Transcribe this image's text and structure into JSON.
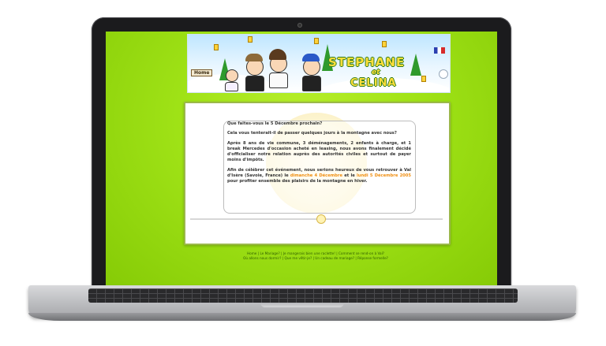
{
  "banner": {
    "title_line1": "STEPHANE",
    "title_et": "et",
    "title_line2": "CELINA",
    "home_sign": "Home"
  },
  "content": {
    "q1": "Que faites-vous le 5 Décembre prochain?",
    "q2": "Cela vous tenterait-il de passer quelques jours à la montagne avec nous?",
    "p1": "Après 8 ans de vie commune, 3 déménagements, 2 enfants à charge, et 1 break Mercedes d'occasion acheté en leasing, nous avons finalement décidé d'officialiser notre relation auprès des autorités civiles et surtout de payer moins d'impôts.",
    "p2_start": "Afin de célébrer cet événement, nous serions heureux de vous retrouver à Val d'Isère (Savoie, France) le ",
    "p2_date1": "dimanche 4 Décembre",
    "p2_mid": " et le ",
    "p2_date2": "lundi 5 Décembre 2005",
    "p2_end": " pour profiter ensemble des plaisirs de la montagne en hiver."
  },
  "footer": {
    "line1": [
      "Home",
      "Le Mariage?",
      "Je mangerais bien une raclette!",
      "Comment se rend-on à Val?"
    ],
    "line2": [
      "Où allons nous dormir?",
      "Que me vêtir-je?",
      "Un cadeau de mariage?",
      "Réponse formelle?"
    ],
    "separator": " | "
  },
  "colors": {
    "background_green": "#9fe216",
    "highlight_orange": "#f08f12"
  }
}
